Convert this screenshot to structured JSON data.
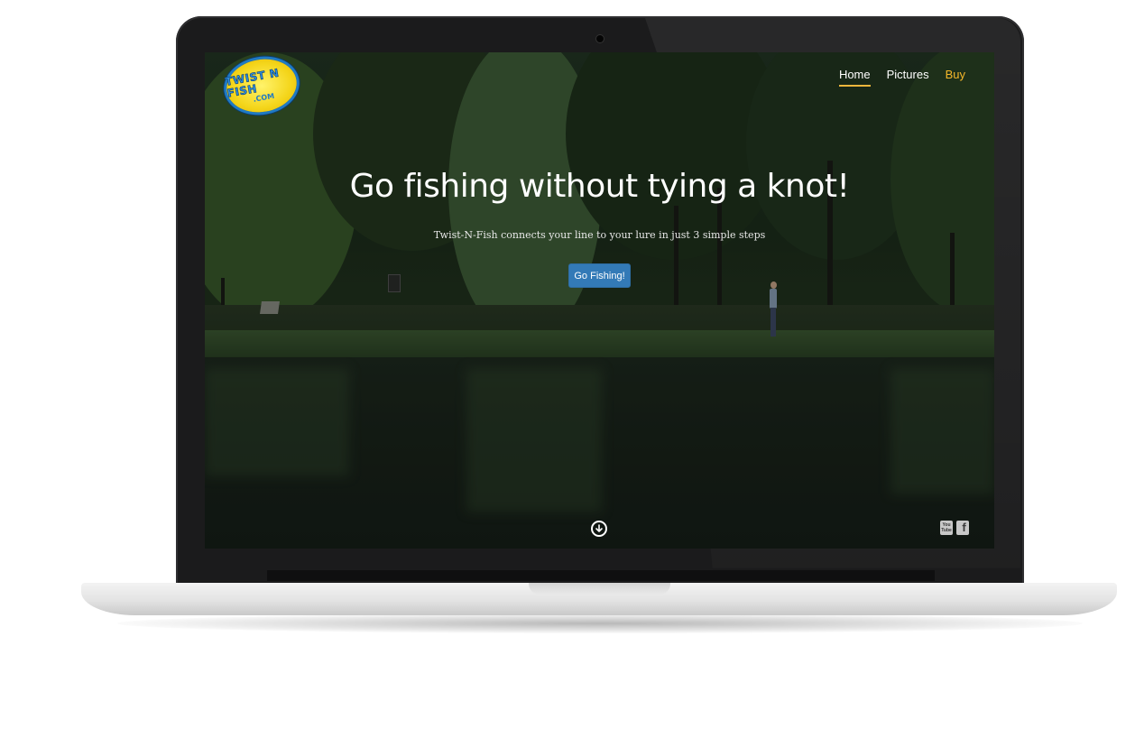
{
  "site": {
    "logo": {
      "text_main": "TWIST N FISH",
      "text_sub": ".COM"
    },
    "nav": {
      "items": [
        {
          "label": "Home",
          "active": true
        },
        {
          "label": "Pictures",
          "active": false
        },
        {
          "label": "Buy",
          "active": false
        }
      ]
    },
    "hero": {
      "title": "Go fishing without tying a knot!",
      "subtitle": "Twist-N-Fish connects your line to your lure in just 3 simple steps",
      "cta_label": "Go Fishing!"
    },
    "social": {
      "youtube_text": "You Tube",
      "facebook_text": "f"
    },
    "icons": {
      "scroll": "arrow-down-circle-icon",
      "youtube": "youtube-icon",
      "facebook": "facebook-icon"
    },
    "colors": {
      "accent": "#f5b72a",
      "button": "#337ab7",
      "bezel": "#1b1b1c"
    }
  }
}
